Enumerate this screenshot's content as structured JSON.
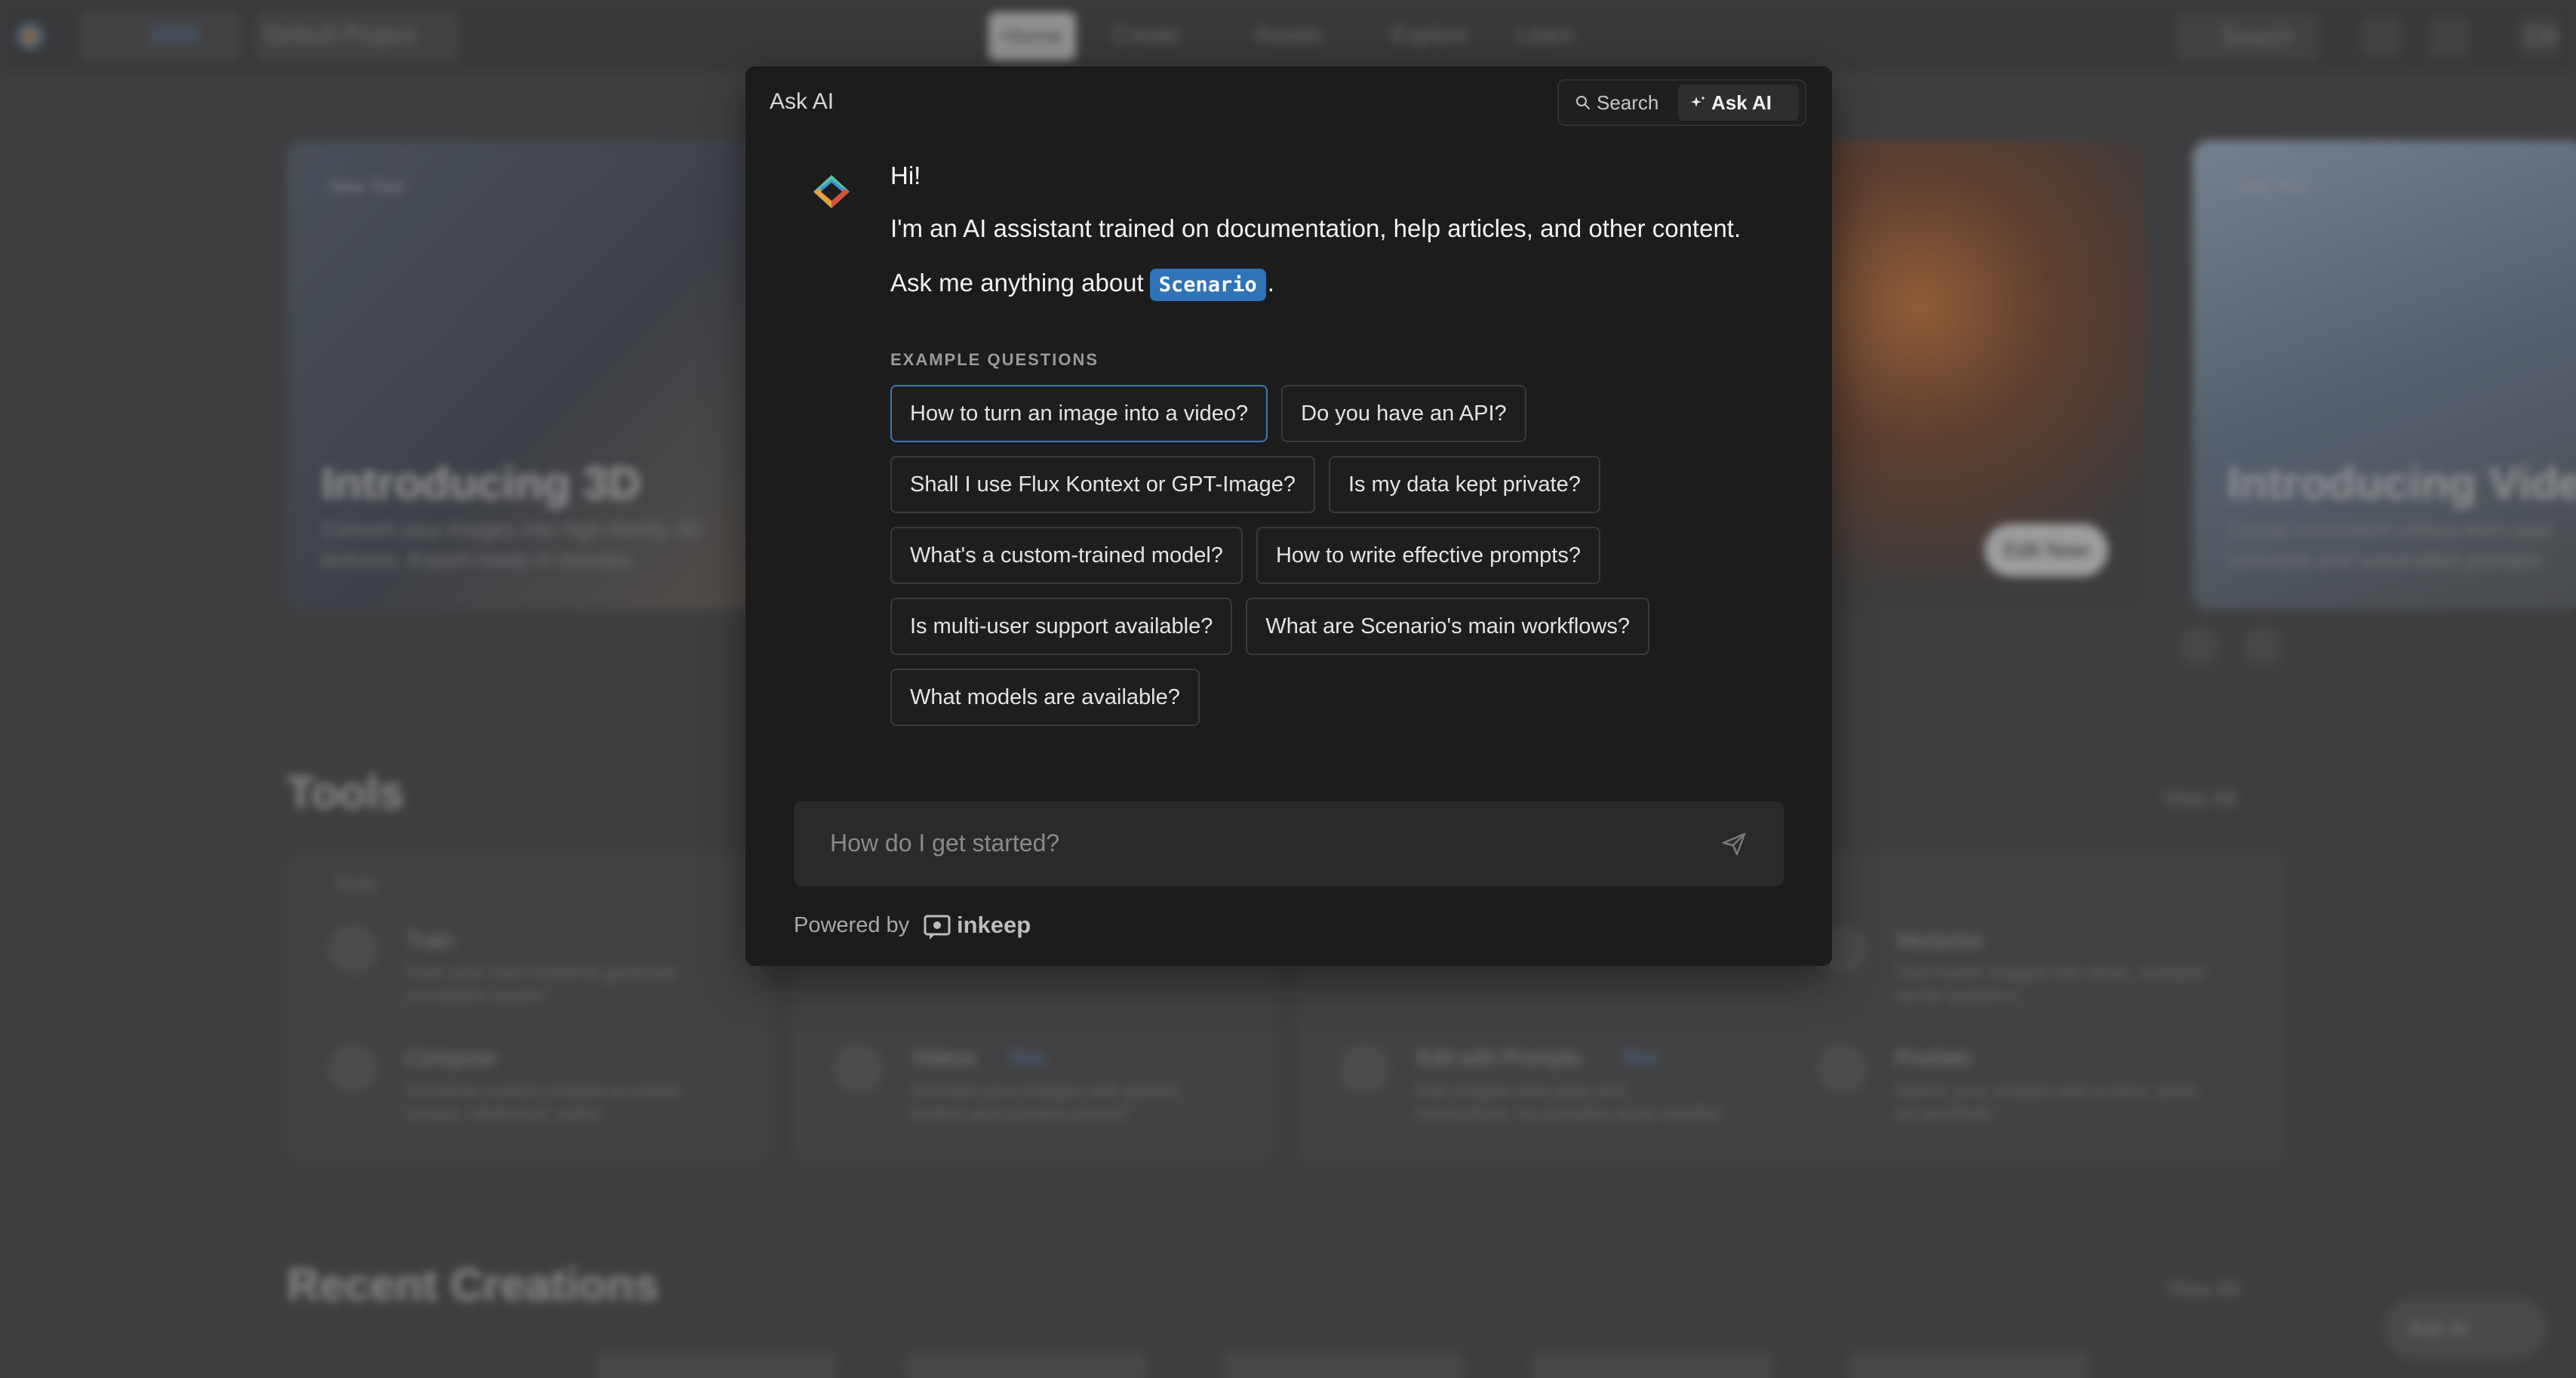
{
  "background": {
    "nav": {
      "credits": "1004",
      "project": "Default Project",
      "items": [
        "Home",
        "Create",
        "Assets",
        "Explore",
        "Learn"
      ],
      "search_label": "Search",
      "avatar_initials": "EM"
    },
    "hero": [
      {
        "badge": "New Tool",
        "title": "Introducing 3D",
        "subtitle": "Convert your images into high-fidelity 3D",
        "subtitle2": "textures. Export-ready in minutes."
      },
      {
        "button": "Edit Now"
      },
      {
        "badge": "New Tool",
        "title": "Introducing Vide",
        "subtitle": "Create consistent videos from your",
        "subtitle2": "concepts and automated prompts"
      }
    ],
    "tools": {
      "title": "Tools",
      "view_all": "View All",
      "panel_label": "Tools",
      "items": [
        {
          "name": "Train",
          "desc": "Train your own model to generate",
          "desc2": "consistent assets"
        },
        {
          "name": "Compose",
          "desc": "Combine custom models to create",
          "desc2": "unique, distinctive styles"
        },
        {
          "name": "Videos",
          "badge": "New",
          "desc": "Animate your images with guided",
          "desc2": "motion and camera control"
        },
        {
          "name": "Edit with Prompts",
          "badge": "New",
          "desc": "Edit images with plain text",
          "desc2": "instructions, no complex tools needed"
        },
        {
          "name": "Vectorize",
          "desc": "Turn raster images into clean, scalable",
          "desc2": "vector graphics"
        },
        {
          "name": "Pixelate",
          "desc": "Stylize your images with a retro, pixel-",
          "desc2": "art aesthetic"
        }
      ]
    },
    "recent": {
      "title": "Recent Creations",
      "view_all": "View All"
    },
    "ask_fab": "Ask AI"
  },
  "modal": {
    "title": "Ask AI",
    "switch": {
      "search": "Search",
      "ask_ai": "Ask AI"
    },
    "greeting": "Hi!",
    "intro": "I'm an AI assistant trained on documentation, help articles, and other content.",
    "ask_prefix": "Ask me anything about",
    "product": "Scenario",
    "ask_suffix": ".",
    "examples_heading": "EXAMPLE QUESTIONS",
    "examples": [
      "How to turn an image into a video?",
      "Do you have an API?",
      "Shall I use Flux Kontext or GPT-Image?",
      "Is my data kept private?",
      "What's a custom-trained model?",
      "How to write effective prompts?",
      "Is multi-user support available?",
      "What are Scenario's main workflows?",
      "What models are available?"
    ],
    "input_placeholder": "How do I get started?",
    "powered_by": "Powered by",
    "brand": "inkeep"
  },
  "colors": {
    "accent": "#2f73b8",
    "modal_bg": "#1c1c1c",
    "focus_border": "#3d78b5"
  }
}
